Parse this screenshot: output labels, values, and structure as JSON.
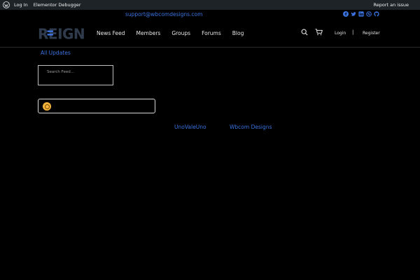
{
  "admin_bar": {
    "login_label": "Log In",
    "debugger_label": "Elementor Debugger",
    "report_label": "Report an issue"
  },
  "topbar": {
    "email": "support@wbcomdesigns.com",
    "social_icons": [
      "facebook-icon",
      "twitter-icon",
      "linkedin-icon",
      "dribbble-icon",
      "github-icon"
    ]
  },
  "header": {
    "logo_text": "REIGN",
    "nav": [
      "News Feed",
      "Members",
      "Groups",
      "Forums",
      "Blog"
    ],
    "login_label": "Login",
    "separator": "|",
    "register_label": "Register"
  },
  "main": {
    "all_updates": "All Updates",
    "search_placeholder": "Search Feed..."
  },
  "footer": {
    "link1": "UnoVaIeUno",
    "link2": "Wbcom Designs"
  },
  "colors": {
    "accent": "#3a73e0",
    "avatar": "#f2b43c",
    "admin_bar": "#1d2327"
  }
}
